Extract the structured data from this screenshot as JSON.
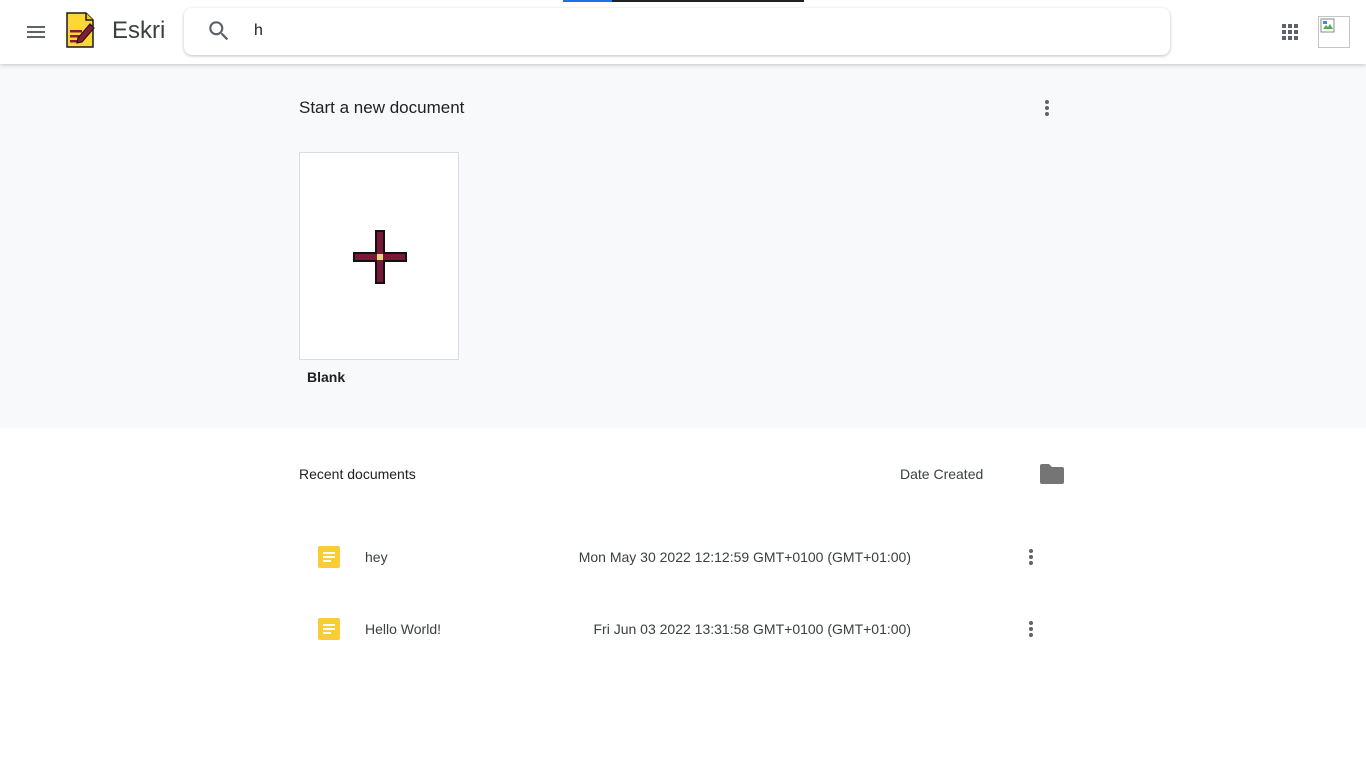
{
  "header": {
    "app_name": "Eskri",
    "menu_icon": "hamburger-menu-icon",
    "logo_icon": "notepad-pencil-logo-icon",
    "search": {
      "icon": "search-icon",
      "value": "h"
    },
    "apps_icon": "apps-grid-icon",
    "avatar_icon": "broken-image-icon"
  },
  "new_document": {
    "title": "Start a new document",
    "more_icon": "more-vert-icon",
    "templates": [
      {
        "label": "Blank",
        "icon": "plus-icon"
      }
    ]
  },
  "recent": {
    "title": "Recent documents",
    "sort_label": "Date Created",
    "folder_icon": "folder-icon",
    "documents": [
      {
        "title": "hey",
        "date": "Mon May 30 2022 12:12:59 GMT+0100 (GMT+01:00)",
        "icon": "document-icon"
      },
      {
        "title": "Hello World!",
        "date": "Fri Jun 03 2022 13:31:58 GMT+0100 (GMT+01:00)",
        "icon": "document-icon"
      }
    ]
  },
  "colors": {
    "accent_blue": "#1a73e8",
    "doc_icon_yellow": "#fbcc33",
    "plus_fill": "#7b1838",
    "section_bg": "#f8f9fa"
  }
}
